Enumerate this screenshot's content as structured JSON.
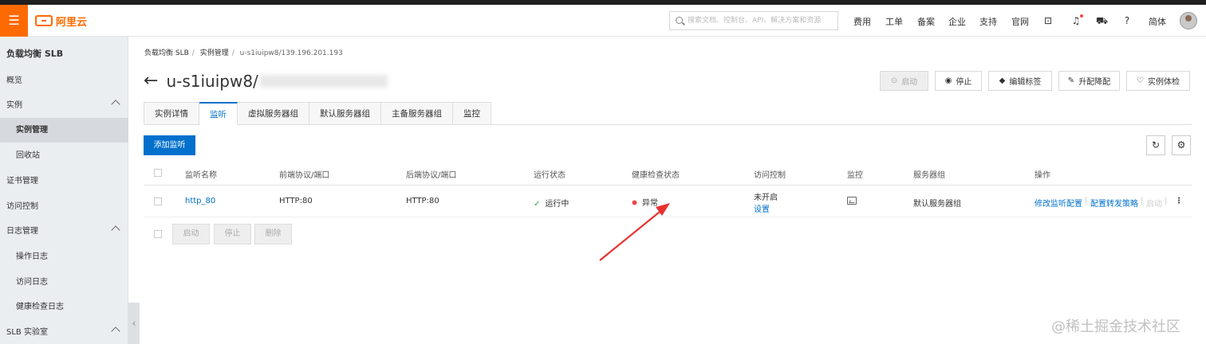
{
  "topbar": {
    "logo_text": "阿里云",
    "search_placeholder": "搜索文档、控制台、API、解决方案和资源",
    "nav": [
      "费用",
      "工单",
      "备案",
      "企业",
      "支持",
      "官网"
    ],
    "lang": "简体",
    "icons": [
      "terminal-icon",
      "bell-icon",
      "cart-icon",
      "help-icon"
    ]
  },
  "sidebar": {
    "title": "负载均衡 SLB",
    "items": [
      {
        "label": "概览"
      },
      {
        "label": "实例"
      },
      {
        "label": "实例管理"
      },
      {
        "label": "回收站"
      },
      {
        "label": "证书管理"
      },
      {
        "label": "访问控制"
      },
      {
        "label": "日志管理"
      },
      {
        "label": "操作日志"
      },
      {
        "label": "访问日志"
      },
      {
        "label": "健康检查日志"
      },
      {
        "label": "SLB 实验室"
      }
    ]
  },
  "breadcrumb": [
    "负载均衡 SLB",
    "实例管理",
    "u-s1iuipw8/139.196.201.193"
  ],
  "page": {
    "title": "u-s1iuipw8/"
  },
  "actions": {
    "start": "启动",
    "stop": "停止",
    "edit_tags": "编辑标签",
    "upgrade": "升配降配",
    "health_check": "实例体检"
  },
  "tabs": [
    "实例详情",
    "监听",
    "虚拟服务器组",
    "默认服务器组",
    "主备服务器组",
    "监控"
  ],
  "add_listener": "添加监听",
  "table": {
    "headers": [
      "监听名称",
      "前端协议/端口",
      "后端协议/端口",
      "运行状态",
      "健康检查状态",
      "访问控制",
      "监控",
      "服务器组",
      "操作"
    ],
    "row": {
      "name": "http_80",
      "frontend": "HTTP:80",
      "backend": "HTTP:80",
      "run_status": "运行中",
      "health_status": "异常",
      "access_control": "未开启",
      "access_control_link": "设置",
      "server_group": "默认服务器组",
      "op_modify": "修改监听配置",
      "op_forward": "配置转发策略",
      "op_start": "启动"
    }
  },
  "bulk": {
    "start": "启动",
    "stop": "停止",
    "delete": "删除"
  },
  "watermark": "@稀土掘金技术社区",
  "colors": {
    "brand": "#ff6a00",
    "primary": "#0070cc",
    "error": "#e84040",
    "success": "#1ea74a",
    "annotation_arrow": "#e8312f"
  }
}
